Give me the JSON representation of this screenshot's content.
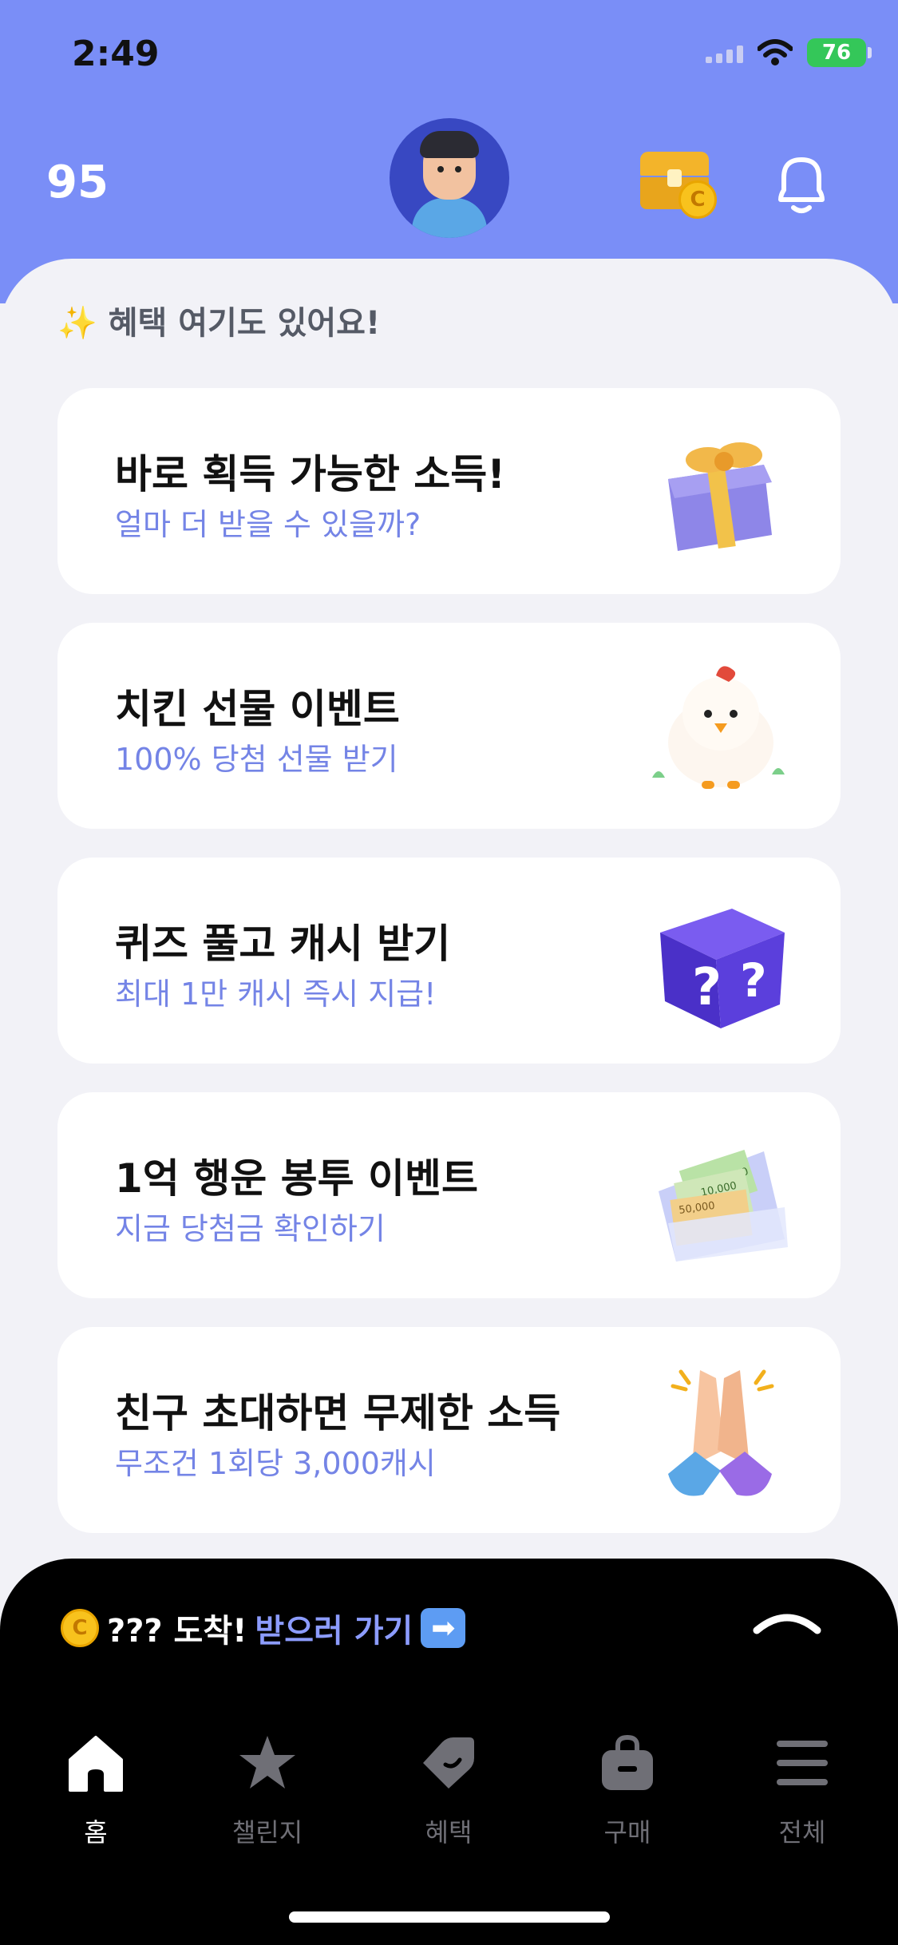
{
  "status_bar": {
    "time": "2:49",
    "battery": "76"
  },
  "header": {
    "points": "95"
  },
  "section": {
    "title": "✨ 혜택 여기도 있어요!"
  },
  "cards": [
    {
      "title": "바로 획득 가능한 소득!",
      "subtitle": "얼마 더 받을 수 있을까?",
      "icon": "gift-box-icon"
    },
    {
      "title": "치킨 선물 이벤트",
      "subtitle": "100% 당첨 선물 받기",
      "icon": "chick-icon"
    },
    {
      "title": "퀴즈 풀고 캐시 받기",
      "subtitle": "최대 1만 캐시 즉시 지급!",
      "icon": "mystery-box-icon"
    },
    {
      "title": "1억 행운 봉투 이벤트",
      "subtitle": "지금 당첨금 확인하기",
      "icon": "money-envelope-icon"
    },
    {
      "title": "친구 초대하면 무제한 소득",
      "subtitle": "무조건 1회당 3,000캐시",
      "icon": "high-five-icon"
    }
  ],
  "envelope_bills": [
    "1,000",
    "10,000",
    "50,000"
  ],
  "coin_symbol": "C",
  "banner": {
    "text": "??? 도착!",
    "link": "받으러 가기",
    "arrow": "➡"
  },
  "nav": [
    {
      "label": "홈",
      "icon": "home-icon",
      "active": true
    },
    {
      "label": "챌린지",
      "icon": "star-icon",
      "active": false
    },
    {
      "label": "혜택",
      "icon": "tag-icon",
      "active": false
    },
    {
      "label": "구매",
      "icon": "shopping-bag-icon",
      "active": false
    },
    {
      "label": "전체",
      "icon": "menu-icon",
      "active": false
    }
  ],
  "colors": {
    "header_bg": "#7a8ef7",
    "accent_text": "#7484e6",
    "link": "#8c9cff",
    "bottom_bar": "#000000"
  }
}
